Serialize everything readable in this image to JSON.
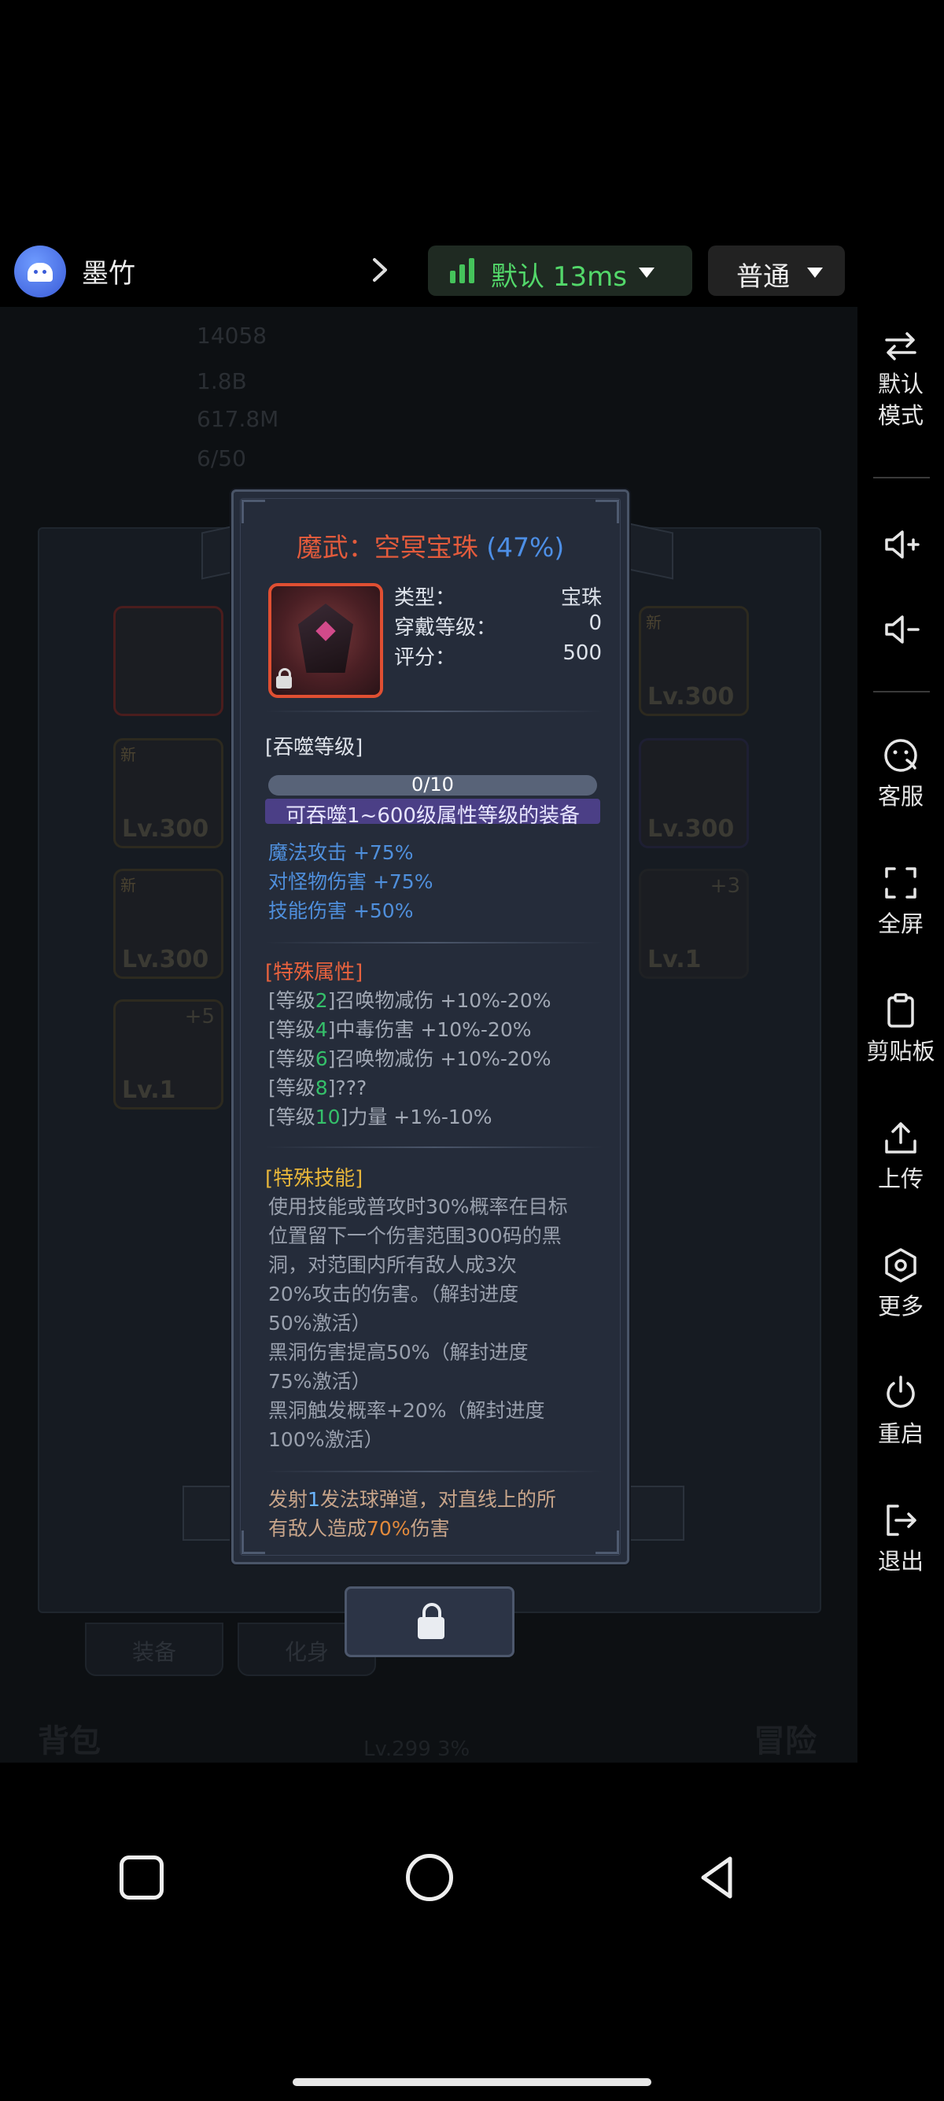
{
  "topbar": {
    "app_name": "墨竹",
    "network": "默认 13ms",
    "mode": "普通"
  },
  "tooltip": {
    "title_prefix": "魔武：空冥宝珠",
    "title_pct": "(47%)",
    "stats": [
      {
        "label": "类型：",
        "value": "宝珠"
      },
      {
        "label": "穿戴等级：",
        "value": "0"
      },
      {
        "label": "评分：",
        "value": "500"
      }
    ],
    "devour_header": "[吞噬等级]",
    "devour_progress": "0/10",
    "devour_progress_value": 0,
    "devour_range": "可吞噬1~600级属性等级的装备",
    "bonuses": [
      "魔法攻击 +75%",
      "对怪物伤害 +75%",
      "技能伤害 +50%"
    ],
    "special_attr_header": "[特殊属性]",
    "special_attrs": [
      {
        "pre": "[等级",
        "lvl": "2",
        "post": "]召唤物减伤 +10%-20%"
      },
      {
        "pre": "[等级",
        "lvl": "4",
        "post": "]中毒伤害 +10%-20%"
      },
      {
        "pre": "[等级",
        "lvl": "6",
        "post": "]召唤物减伤 +10%-20%"
      },
      {
        "pre": "[等级",
        "lvl": "8",
        "post": "]???"
      },
      {
        "pre": "[等级",
        "lvl": "10",
        "post": "]力量 +1%-10%"
      }
    ],
    "special_skill_header": "[特殊技能]",
    "skill_lines": [
      "使用技能或普攻时30%概率在目标",
      "位置留下一个伤害范围300码的黑",
      "洞，对范围内所有敌人成3次",
      "20%攻击的伤害。（解封进度",
      "50%激活）",
      "黑洞伤害提高50%（解封进度",
      "75%激活）",
      "黑洞触发概率+20%（解封进度",
      "100%激活）"
    ],
    "foot_1a": "发射",
    "foot_1b": "1",
    "foot_1c": "发法球弹道，对直线上的所",
    "foot_2a": "有敌人造成",
    "foot_2b": "70%",
    "foot_2c": "伤害"
  },
  "background": {
    "hud": [
      "14058",
      "1.8B",
      "617.8M",
      "6/50"
    ],
    "slots_left": [
      {
        "lv": "",
        "new": "",
        "plus": ""
      },
      {
        "lv": "Lv.300",
        "new": "新",
        "plus": ""
      },
      {
        "lv": "Lv.300",
        "new": "新",
        "plus": ""
      },
      {
        "lv": "Lv.1",
        "new": "",
        "plus": "+5"
      }
    ],
    "slots_right": [
      {
        "lv": "Lv.300",
        "new": "新",
        "plus": ""
      },
      {
        "lv": "Lv.300",
        "new": "",
        "plus": ""
      },
      {
        "lv": "Lv.1",
        "new": "",
        "plus": "+3"
      }
    ],
    "tabs": [
      "装备",
      "化身"
    ],
    "corner_left": "背包",
    "corner_right": "冒险",
    "level_text": "Lv.299 3%"
  },
  "sidebar": {
    "items": [
      "默认\n模式",
      "",
      "",
      "客服",
      "全屏",
      "剪贴板",
      "上传",
      "更多",
      "重启",
      "退出"
    ],
    "default_mode_1": "默认",
    "default_mode_2": "模式",
    "service": "客服",
    "fullscreen": "全屏",
    "clipboard": "剪贴板",
    "upload": "上传",
    "more": "更多",
    "restart": "重启",
    "exit": "退出"
  }
}
